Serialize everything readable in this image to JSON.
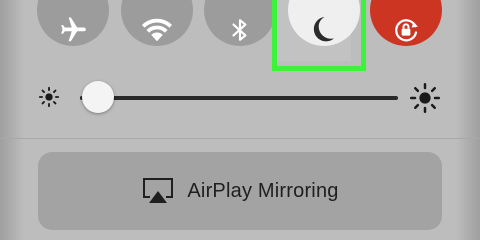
{
  "control_center": {
    "toggles": [
      {
        "id": "airplane",
        "icon": "airplane-icon",
        "state": "off"
      },
      {
        "id": "wifi",
        "icon": "wifi-icon",
        "state": "off"
      },
      {
        "id": "bluetooth",
        "icon": "bluetooth-icon",
        "state": "off"
      },
      {
        "id": "do-not-disturb",
        "icon": "moon-icon",
        "state": "on",
        "highlighted": true
      },
      {
        "id": "rotation-lock",
        "icon": "rotation-lock-icon",
        "state": "on"
      }
    ],
    "brightness": {
      "level": 0.02,
      "min_icon": "sun-small-icon",
      "max_icon": "sun-large-icon"
    },
    "airplay": {
      "label": "AirPlay Mirroring",
      "icon": "airplay-icon"
    }
  },
  "colors": {
    "panel_bg": "#bdbdbd",
    "toggle_off": "#9c9c9c",
    "toggle_dnd_on": "#eeeeee",
    "toggle_rotation_on": "#cc3522",
    "highlight": "#3cf23a",
    "airplay_bg": "#a3a3a3"
  }
}
